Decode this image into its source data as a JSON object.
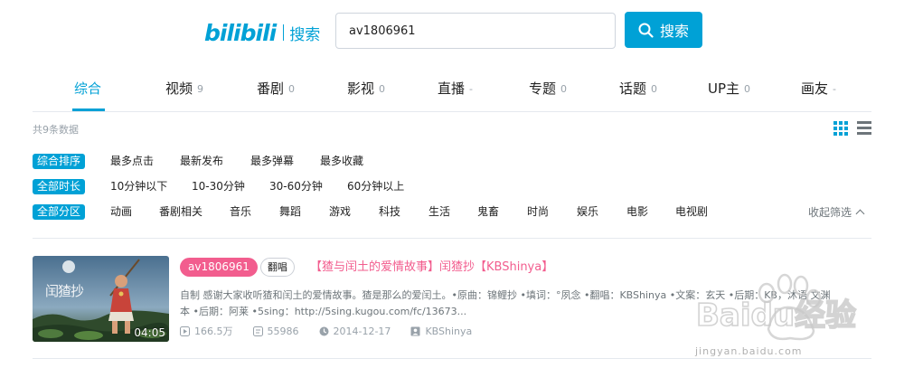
{
  "header": {
    "logo_text": "bilibili",
    "logo_subtitle": "搜索",
    "search_value": "av1806961",
    "search_button_label": "搜索"
  },
  "tabs": [
    {
      "label": "综合",
      "count": ""
    },
    {
      "label": "视频",
      "count": "9"
    },
    {
      "label": "番剧",
      "count": "0"
    },
    {
      "label": "影视",
      "count": "0"
    },
    {
      "label": "直播",
      "count": "-"
    },
    {
      "label": "专题",
      "count": "0"
    },
    {
      "label": "话题",
      "count": "0"
    },
    {
      "label": "UP主",
      "count": "0"
    },
    {
      "label": "画友",
      "count": "-"
    }
  ],
  "active_tab": "综合",
  "summary": {
    "total_text": "共9条数据"
  },
  "filters": {
    "sort": {
      "active": "综合排序",
      "options": [
        "最多点击",
        "最新发布",
        "最多弹幕",
        "最多收藏"
      ]
    },
    "duration": {
      "active": "全部时长",
      "options": [
        "10分钟以下",
        "10-30分钟",
        "30-60分钟",
        "60分钟以上"
      ]
    },
    "zone": {
      "active": "全部分区",
      "options": [
        "动画",
        "番剧相关",
        "音乐",
        "舞蹈",
        "游戏",
        "科技",
        "生活",
        "鬼畜",
        "时尚",
        "娱乐",
        "电影",
        "电视剧"
      ]
    },
    "fold_label": "收起筛选"
  },
  "result": {
    "av_id": "av1806961",
    "type_tag": "翻唱",
    "title": "【猹与闰土的爱情故事】闰猹抄【KBShinya】",
    "thumbnail_caption": "闰猹抄",
    "duration": "04:05",
    "description_line1": "自制 感谢大家收听猹和闰土的爱情故事。猹是那么的爱闰土。•原曲：锦鲤抄 •填词：°夙念 •翻唱：KBShinya •文案：玄天 •后期：KB，沐语 文渊",
    "description_line2": "本 •后期：阿莱 •5sing：http://5sing.kugou.com/fc/13673...",
    "views": "166.5万",
    "danmaku": "55986",
    "date": "2014-12-17",
    "uploader": "KBShinya"
  },
  "watermark": {
    "text": "Baidu经验",
    "url_text": "jingyan.baidu.com"
  },
  "colors": {
    "accent": "#00a1d6",
    "pink": "#f25d8e",
    "muted": "#99a2aa",
    "text": "#222222"
  }
}
